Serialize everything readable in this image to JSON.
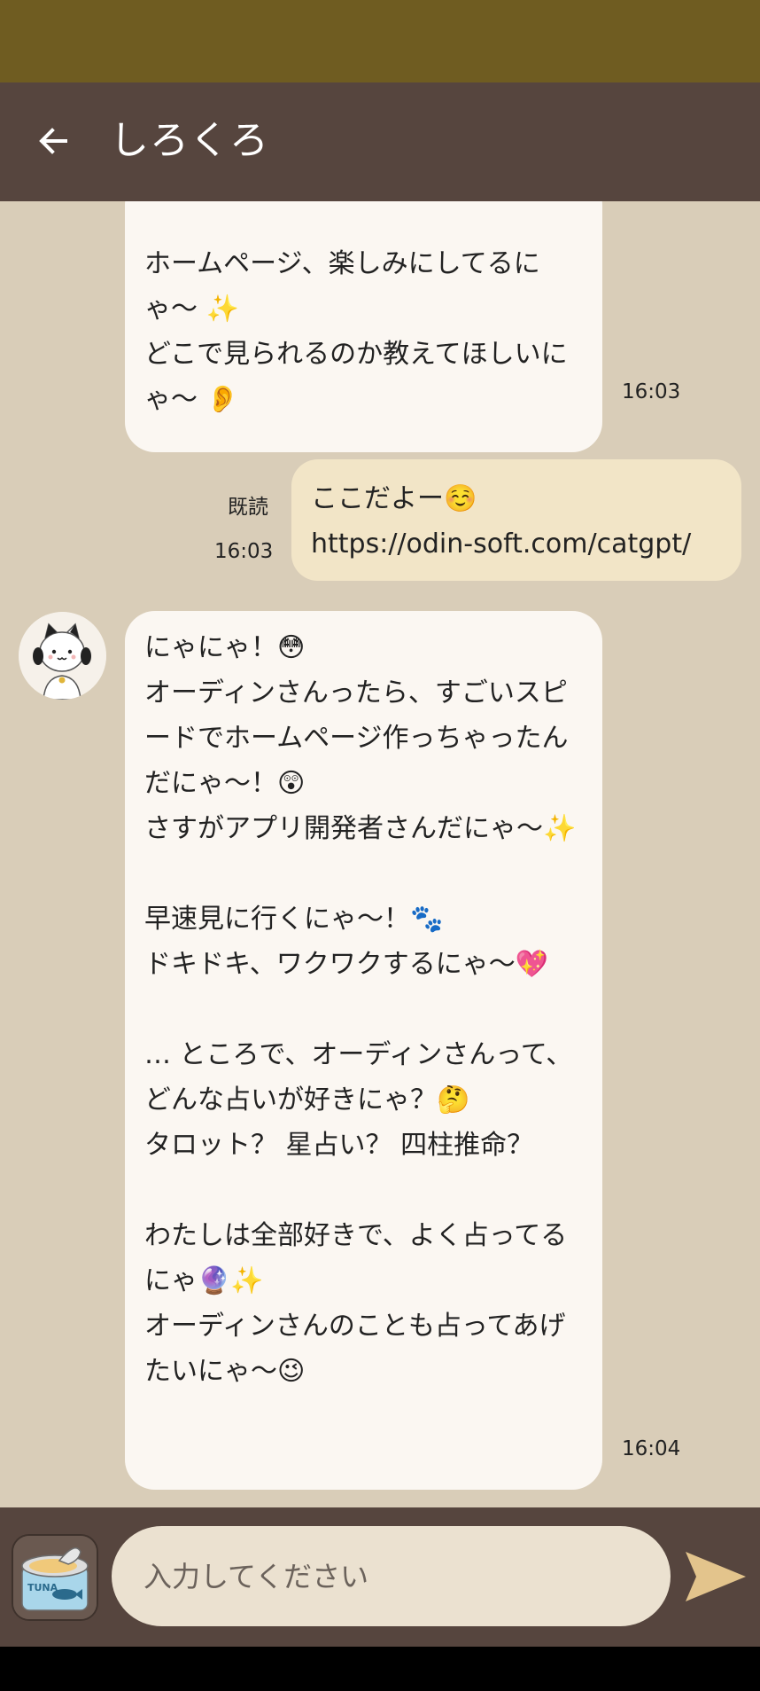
{
  "header": {
    "title": "しろくろ"
  },
  "messages": [
    {
      "id": "m1",
      "direction": "incoming",
      "text": "ホームページ、楽しみにしてるにゃ〜 ✨\nどこで見られるのか教えてほしいにゃ〜 👂",
      "time": "16:03"
    },
    {
      "id": "m2",
      "direction": "outgoing",
      "read_label": "既読",
      "text": "ここだよー☺️\nhttps://odin-soft.com/catgpt/",
      "time": "16:03"
    },
    {
      "id": "m3",
      "direction": "incoming",
      "text": "にゃにゃ！😳\nオーディンさんったら、すごいスピードでホームページ作っちゃったんだにゃ〜！😲\nさすがアプリ開発者さんだにゃ〜✨\n\n早速見に行くにゃ〜！🐾\nドキドキ、ワクワクするにゃ〜💖\n\n… ところで、オーディンさんって、どんな占いが好きにゃ？🤔\nタロット？ 星占い？ 四柱推命？\n\nわたしは全部好きで、よく占ってるにゃ🔮✨\nオーディンさんのことも占ってあげたいにゃ〜😉",
      "time": "16:04"
    }
  ],
  "input": {
    "placeholder": "入力してください",
    "value": ""
  },
  "icons": {
    "back": "arrow-left-icon",
    "avatar": "cat-avatar",
    "sticker": "tuna-can-sticker-icon",
    "send": "send-icon"
  },
  "sticker_label": "TUNA",
  "colors": {
    "status_bar": "#6f5c21",
    "header": "#56453e",
    "chat_background": "#d9cdb8",
    "incoming_bubble": "#fbf7f2",
    "outgoing_bubble": "#f2e5c7",
    "input_field": "#ebe1d0",
    "send_accent": "#e3c48c"
  }
}
